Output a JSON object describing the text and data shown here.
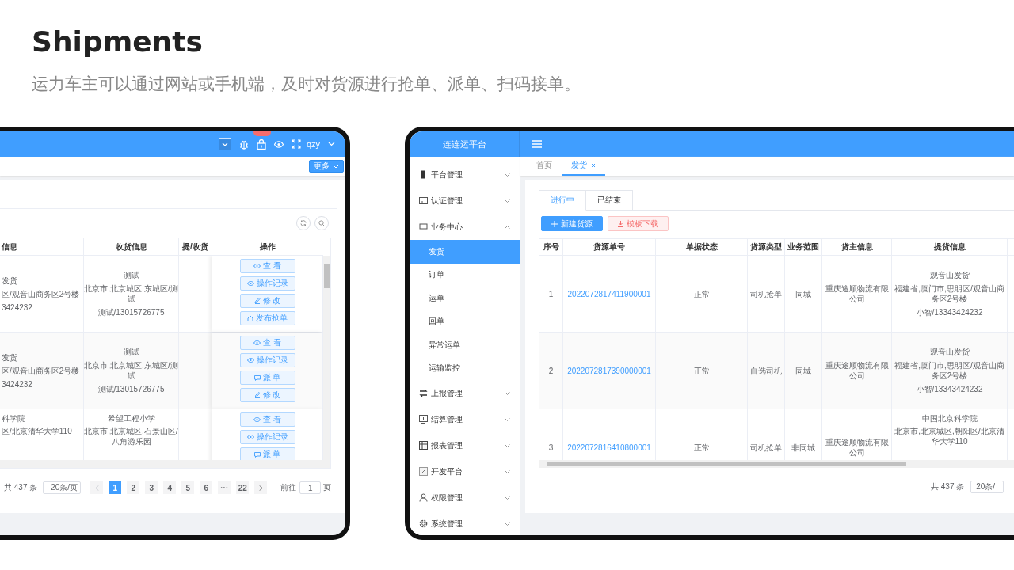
{
  "title": "Shipments",
  "subtitle": "运力车主可以通过网站或手机端，及时对货源进行抢单、派单、扫码接单。",
  "left_screen": {
    "user": "qzy",
    "more_button": "更多",
    "table": {
      "columns": [
        "信息",
        "收货信息",
        "提/收货",
        "操作"
      ],
      "rows": [
        {
          "column_1": [
            "发货",
            "区/观音山商务区2号楼",
            "3424232"
          ],
          "consignee": [
            "测试",
            "北京市,北京城区,东城区/测试",
            "测试/13015726775"
          ],
          "actions": [
            {
              "label": "查 看",
              "kind": "view"
            },
            {
              "label": "操作记录",
              "kind": "log"
            },
            {
              "label": "修 改",
              "kind": "edit"
            },
            {
              "label": "发布抢单",
              "kind": "publish"
            }
          ]
        },
        {
          "column_1": [
            "发货",
            "区/观音山商务区2号楼",
            "3424232"
          ],
          "consignee": [
            "测试",
            "北京市,北京城区,东城区/测试",
            "测试/13015726775"
          ],
          "actions": [
            {
              "label": "查 看",
              "kind": "view"
            },
            {
              "label": "操作记录",
              "kind": "log"
            },
            {
              "label": "派 单",
              "kind": "dispatch"
            },
            {
              "label": "修 改",
              "kind": "edit"
            }
          ]
        },
        {
          "column_1": [
            "科学院",
            "区/北京清华大学110"
          ],
          "consignee": [
            "希望工程小学",
            "北京市,北京城区,石景山区/八角游乐园"
          ],
          "actions": [
            {
              "label": "查 看",
              "kind": "view"
            },
            {
              "label": "操作记录",
              "kind": "log"
            },
            {
              "label": "派 单",
              "kind": "dispatch"
            }
          ]
        }
      ]
    },
    "pagination": {
      "total": "共 437 条",
      "page_size": "20条/页",
      "pages": [
        {
          "label": "1",
          "selected": true
        },
        {
          "label": "2",
          "selected": false
        },
        {
          "label": "3",
          "selected": false
        },
        {
          "label": "4",
          "selected": false
        },
        {
          "label": "5",
          "selected": false
        },
        {
          "label": "6",
          "selected": false
        },
        {
          "label": "···",
          "selected": false
        },
        {
          "label": "22",
          "selected": false
        }
      ],
      "goto_label": "前往",
      "goto_value": "1",
      "page_unit": "页"
    }
  },
  "right_screen": {
    "logo": "连连运平台",
    "sidebar": [
      {
        "label": "平台管理",
        "expanded": false
      },
      {
        "label": "认证管理",
        "expanded": false
      },
      {
        "label": "业务中心",
        "expanded": true,
        "children": [
          {
            "label": "发货",
            "selected": true
          },
          {
            "label": "订单",
            "selected": false
          },
          {
            "label": "运单",
            "selected": false
          },
          {
            "label": "回单",
            "selected": false
          },
          {
            "label": "异常运单",
            "selected": false
          },
          {
            "label": "运输监控",
            "selected": false
          }
        ]
      },
      {
        "label": "上报管理",
        "expanded": false
      },
      {
        "label": "结算管理",
        "expanded": false
      },
      {
        "label": "报表管理",
        "expanded": false
      },
      {
        "label": "开发平台",
        "expanded": false
      },
      {
        "label": "权限管理",
        "expanded": false
      },
      {
        "label": "系统管理",
        "expanded": false
      }
    ],
    "page_tabs": [
      {
        "label": "首页",
        "selected": false,
        "closable": false
      },
      {
        "label": "发货",
        "selected": true,
        "closable": true
      }
    ],
    "status_tabs": [
      {
        "label": "进行中",
        "selected": true
      },
      {
        "label": "已结束",
        "selected": false
      }
    ],
    "buttons": [
      {
        "label": "新建货源",
        "kind": "primary"
      },
      {
        "label": "模板下载",
        "kind": "danger"
      }
    ],
    "table": {
      "columns": [
        "序号",
        "货源单号",
        "单据状态",
        "货源类型",
        "业务范围",
        "货主信息",
        "提货信息"
      ],
      "rows": [
        {
          "index": "1",
          "number": "2022072817411900001",
          "status": "正常",
          "type": "司机抢单",
          "scope": "同城",
          "shipper": "重庆途顺物流有限公司",
          "pickup": [
            "观音山发货",
            "福建省,厦门市,思明区/观音山商务区2号楼",
            "小智/13343424232"
          ]
        },
        {
          "index": "2",
          "number": "2022072817390000001",
          "status": "正常",
          "type": "自选司机",
          "scope": "同城",
          "shipper": "重庆途顺物流有限公司",
          "pickup": [
            "观音山发货",
            "福建省,厦门市,思明区/观音山商务区2号楼",
            "小智/13343424232"
          ]
        },
        {
          "index": "3",
          "number": "2022072816410800001",
          "status": "正常",
          "type": "司机抢单",
          "scope": "非同城",
          "shipper": "重庆途顺物流有限公司",
          "pickup": [
            "中国北京科学院",
            "北京市,北京城区,朝阳区/北京清华大学110"
          ]
        }
      ]
    },
    "pagination": {
      "total": "共 437 条",
      "page_size": "20条/"
    }
  }
}
